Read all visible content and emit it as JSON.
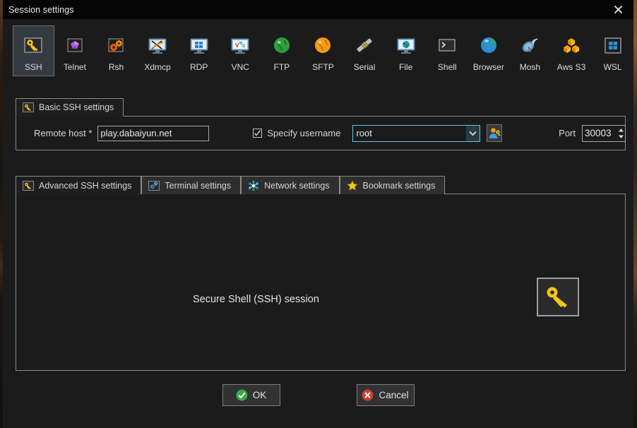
{
  "window": {
    "title": "Session settings",
    "close_icon": "close-icon"
  },
  "protocols": [
    {
      "label": "SSH",
      "icon": "key-icon",
      "selected": true
    },
    {
      "label": "Telnet",
      "icon": "purple-gem-icon",
      "selected": false
    },
    {
      "label": "Rsh",
      "icon": "orange-gears-icon",
      "selected": false
    },
    {
      "label": "Xdmcp",
      "icon": "x-monitor-icon",
      "selected": false
    },
    {
      "label": "RDP",
      "icon": "windows-monitor-icon",
      "selected": false
    },
    {
      "label": "VNC",
      "icon": "vnc-monitor-icon",
      "selected": false
    },
    {
      "label": "FTP",
      "icon": "green-globe-icon",
      "selected": false
    },
    {
      "label": "SFTP",
      "icon": "orange-globe-icon",
      "selected": false
    },
    {
      "label": "Serial",
      "icon": "serial-plug-icon",
      "selected": false
    },
    {
      "label": "File",
      "icon": "globe-monitor-icon",
      "selected": false
    },
    {
      "label": "Shell",
      "icon": "terminal-prompt-icon",
      "selected": false
    },
    {
      "label": "Browser",
      "icon": "blue-globe-icon",
      "selected": false
    },
    {
      "label": "Mosh",
      "icon": "satellite-dish-icon",
      "selected": false
    },
    {
      "label": "Aws S3",
      "icon": "aws-cubes-icon",
      "selected": false
    },
    {
      "label": "WSL",
      "icon": "windows-logo-icon",
      "selected": false
    }
  ],
  "basic_settings": {
    "tab_label": "Basic SSH settings",
    "tab_icon": "key-icon",
    "remote_host_label": "Remote host *",
    "remote_host_value": "play.dabaiyun.net",
    "remote_host_placeholder": "",
    "specify_username_label": "Specify username",
    "specify_username_checked": true,
    "username_value": "root",
    "username_placeholder": "",
    "username_dropdown_icon": "chevron-down-icon",
    "user_key_button_icon": "user-key-icon",
    "port_label": "Port",
    "port_value": "30003",
    "port_spinner_icon": "spinner-arrows-icon"
  },
  "lower_tabs": [
    {
      "label": "Advanced SSH settings",
      "icon": "key-icon",
      "active": true
    },
    {
      "label": "Terminal settings",
      "icon": "blue-gears-icon",
      "active": false
    },
    {
      "label": "Network settings",
      "icon": "network-icon",
      "active": false
    },
    {
      "label": "Bookmark settings",
      "icon": "star-icon",
      "active": false
    }
  ],
  "session_panel": {
    "description": "Secure Shell (SSH) session",
    "icon": "key-icon"
  },
  "actions": {
    "ok_label": "OK",
    "ok_icon": "green-check-icon",
    "cancel_label": "Cancel",
    "cancel_icon": "red-cross-icon"
  },
  "colors": {
    "window_bg": "#1b1b1b",
    "titlebar_bg": "#050505",
    "selected_tile": "#333a42",
    "focus_border": "#5ec8e8",
    "accent_yellow": "#f5c518",
    "ok_green": "#3aa84a",
    "cancel_red": "#d13c33"
  }
}
